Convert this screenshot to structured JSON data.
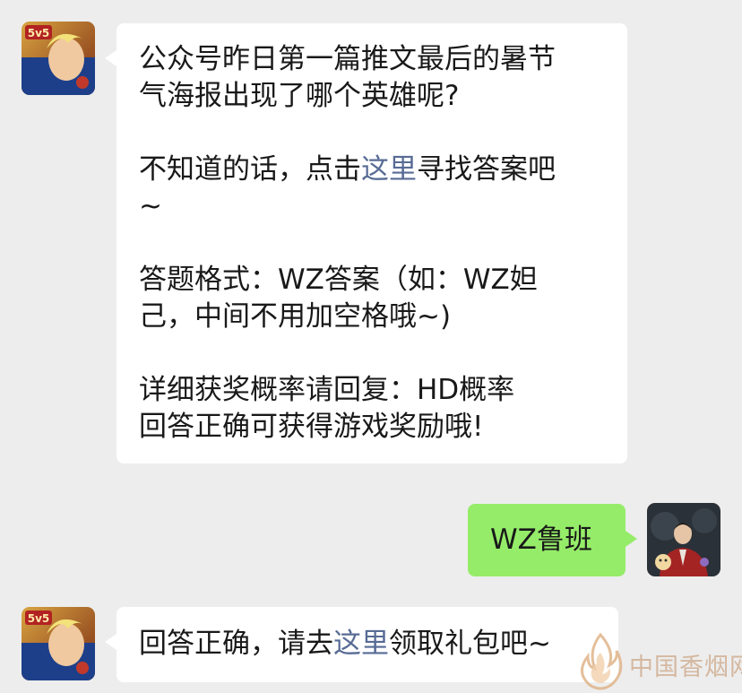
{
  "messages": [
    {
      "sender": "official",
      "avatar": "king-of-glory-5v5-icon",
      "paragraphs": {
        "p1": "公众号昨日第一篇推文最后的暑节\n气海报出现了哪个英雄呢?",
        "p2_before": "不知道的话，点击",
        "p2_link": "这里",
        "p2_after": "寻找答案吧\n~",
        "p3": "答题格式：WZ答案（如：WZ妲\n己，中间不用加空格哦~)",
        "p4": "详细获奖概率请回复：HD概率\n回答正确可获得游戏奖励哦!"
      }
    },
    {
      "sender": "user",
      "avatar": "user-portrait-icon",
      "text": "WZ鲁班"
    },
    {
      "sender": "official",
      "avatar": "king-of-glory-5v5-icon",
      "before": "回答正确，请去",
      "link": "这里",
      "after": "领取礼包吧~"
    }
  ],
  "watermark": {
    "text": "中国香烟网",
    "icon": "flame-logo-icon"
  },
  "colors": {
    "background": "#ededed",
    "bubble_incoming": "#ffffff",
    "bubble_outgoing": "#95ec69",
    "link": "#576b95"
  }
}
